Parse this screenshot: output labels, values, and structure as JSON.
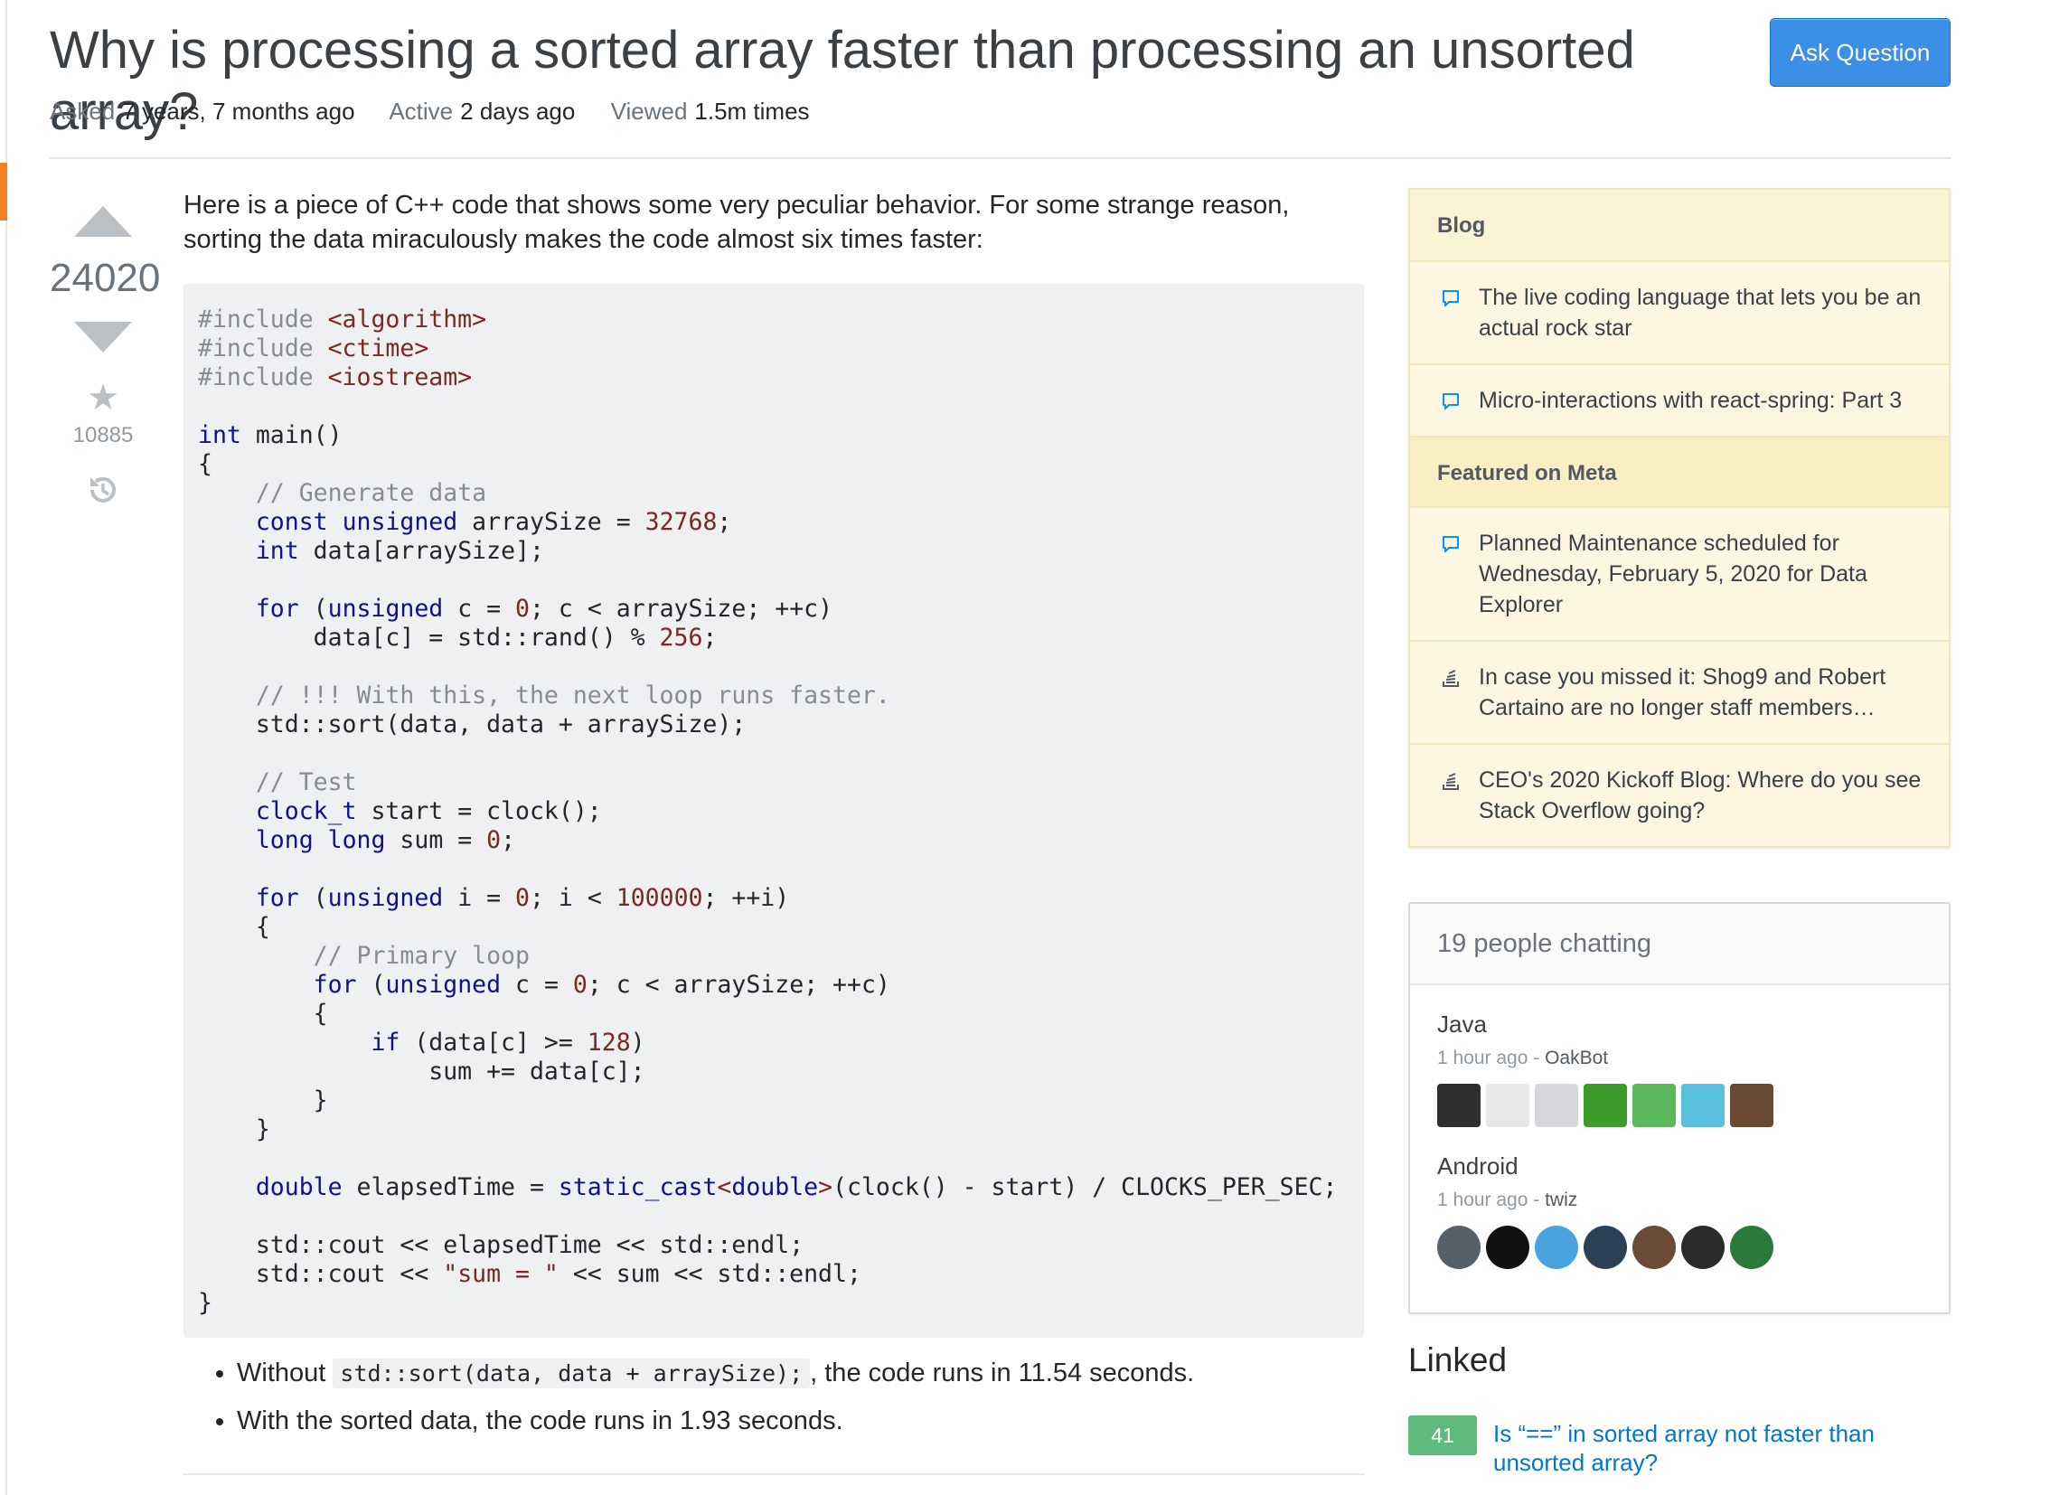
{
  "question": {
    "title": "Why is processing a sorted array faster than processing an unsorted array?",
    "meta": {
      "asked_label": "Asked",
      "asked_value": "7 years, 7 months ago",
      "active_label": "Active",
      "active_value": "2 days ago",
      "viewed_label": "Viewed",
      "viewed_value": "1.5m times"
    },
    "votes": "24020",
    "favorites": "10885",
    "body_intro": "Here is a piece of C++ code that shows some very peculiar behavior. For some strange reason, sorting the data miraculously makes the code almost six times faster:",
    "code_lines": [
      [
        [
          "c",
          "#include "
        ],
        [
          "s",
          "<algorithm>"
        ]
      ],
      [
        [
          "c",
          "#include "
        ],
        [
          "s",
          "<ctime>"
        ]
      ],
      [
        [
          "c",
          "#include "
        ],
        [
          "s",
          "<iostream>"
        ]
      ],
      [],
      [
        [
          "k",
          "int"
        ],
        [
          "p",
          " main()"
        ]
      ],
      [
        [
          "p",
          "{"
        ]
      ],
      [
        [
          "p",
          "    "
        ],
        [
          "c",
          "// Generate data"
        ]
      ],
      [
        [
          "p",
          "    "
        ],
        [
          "k",
          "const"
        ],
        [
          "p",
          " "
        ],
        [
          "k",
          "unsigned"
        ],
        [
          "p",
          " arraySize = "
        ],
        [
          "s",
          "32768"
        ],
        [
          "p",
          ";"
        ]
      ],
      [
        [
          "p",
          "    "
        ],
        [
          "k",
          "int"
        ],
        [
          "p",
          " data[arraySize];"
        ]
      ],
      [],
      [
        [
          "p",
          "    "
        ],
        [
          "k",
          "for"
        ],
        [
          "p",
          " ("
        ],
        [
          "k",
          "unsigned"
        ],
        [
          "p",
          " c = "
        ],
        [
          "s",
          "0"
        ],
        [
          "p",
          "; c < arraySize; ++c)"
        ]
      ],
      [
        [
          "p",
          "        data[c] = std::rand() % "
        ],
        [
          "s",
          "256"
        ],
        [
          "p",
          ";"
        ]
      ],
      [],
      [
        [
          "p",
          "    "
        ],
        [
          "c",
          "// !!! With this, the next loop runs faster."
        ]
      ],
      [
        [
          "p",
          "    std::sort(data, data + arraySize);"
        ]
      ],
      [],
      [
        [
          "p",
          "    "
        ],
        [
          "c",
          "// Test"
        ]
      ],
      [
        [
          "p",
          "    "
        ],
        [
          "k",
          "clock_t"
        ],
        [
          "p",
          " start = clock();"
        ]
      ],
      [
        [
          "p",
          "    "
        ],
        [
          "k",
          "long"
        ],
        [
          "p",
          " "
        ],
        [
          "k",
          "long"
        ],
        [
          "p",
          " sum = "
        ],
        [
          "s",
          "0"
        ],
        [
          "p",
          ";"
        ]
      ],
      [],
      [
        [
          "p",
          "    "
        ],
        [
          "k",
          "for"
        ],
        [
          "p",
          " ("
        ],
        [
          "k",
          "unsigned"
        ],
        [
          "p",
          " i = "
        ],
        [
          "s",
          "0"
        ],
        [
          "p",
          "; i < "
        ],
        [
          "s",
          "100000"
        ],
        [
          "p",
          "; ++i)"
        ]
      ],
      [
        [
          "p",
          "    {"
        ]
      ],
      [
        [
          "p",
          "        "
        ],
        [
          "c",
          "// Primary loop"
        ]
      ],
      [
        [
          "p",
          "        "
        ],
        [
          "k",
          "for"
        ],
        [
          "p",
          " ("
        ],
        [
          "k",
          "unsigned"
        ],
        [
          "p",
          " c = "
        ],
        [
          "s",
          "0"
        ],
        [
          "p",
          "; c < arraySize; ++c)"
        ]
      ],
      [
        [
          "p",
          "        {"
        ]
      ],
      [
        [
          "p",
          "            "
        ],
        [
          "k",
          "if"
        ],
        [
          "p",
          " (data[c] >= "
        ],
        [
          "s",
          "128"
        ],
        [
          "p",
          ")"
        ]
      ],
      [
        [
          "p",
          "                sum += data[c];"
        ]
      ],
      [
        [
          "p",
          "        }"
        ]
      ],
      [
        [
          "p",
          "    }"
        ]
      ],
      [],
      [
        [
          "p",
          "    "
        ],
        [
          "k",
          "double"
        ],
        [
          "p",
          " elapsedTime = "
        ],
        [
          "k",
          "static_cast"
        ],
        [
          "s",
          "<"
        ],
        [
          "k",
          "double"
        ],
        [
          "s",
          ">"
        ],
        [
          "p",
          "(clock() - start) / CLOCKS_PER_SEC;"
        ]
      ],
      [],
      [
        [
          "p",
          "    std::cout << elapsedTime << std::endl;"
        ]
      ],
      [
        [
          "p",
          "    std::cout << "
        ],
        [
          "s",
          "\"sum = \""
        ],
        [
          "p",
          " << sum << std::endl;"
        ]
      ],
      [
        [
          "p",
          "}"
        ]
      ]
    ],
    "bullet1_pre": "Without",
    "bullet1_code": "std::sort(data, data + arraySize);",
    "bullet1_post": ", the code runs in 11.54 seconds.",
    "bullet2": "With the sorted data, the code runs in 1.93 seconds."
  },
  "ask_button": "Ask Question",
  "sidebar": {
    "blog_header": "Blog",
    "blog_items": [
      {
        "icon": "speech-bubble-icon",
        "text": "The live coding language that lets you be an actual rock star"
      },
      {
        "icon": "speech-bubble-icon",
        "text": "Micro-interactions with react-spring: Part 3"
      }
    ],
    "meta_header": "Featured on Meta",
    "meta_items": [
      {
        "icon": "speech-bubble-icon",
        "text": "Planned Maintenance scheduled for Wednesday, February 5, 2020 for Data Explorer"
      },
      {
        "icon": "stack-exchange-icon",
        "text": "In case you missed it: Shog9 and Robert Cartaino are no longer staff members…"
      },
      {
        "icon": "stack-exchange-icon",
        "text": "CEO's 2020 Kickoff Blog: Where do you see Stack Overflow going?"
      }
    ]
  },
  "chat": {
    "header": "19 people chatting",
    "rooms": [
      {
        "name": "Java",
        "time": "1 hour ago",
        "sep": " - ",
        "user": "OakBot",
        "avatars": [
          "#2f2f2f",
          "#e8e8e8",
          "#d5d7da",
          "#3d9b2c",
          "#5cb85c",
          "#5bc0de",
          "#6b4a34"
        ]
      },
      {
        "name": "Android",
        "time": "1 hour ago",
        "sep": " - ",
        "user": "twiz",
        "avatars": [
          "#56606a",
          "#111111",
          "#4aa3df",
          "#2b3f55",
          "#6b4b35",
          "#2a2a2a",
          "#2c7a3a"
        ]
      }
    ]
  },
  "linked": {
    "title": "Linked",
    "items": [
      {
        "score": "41",
        "text": "Is “==” in sorted array not faster than unsorted array?"
      }
    ]
  },
  "colors": {
    "accent": "#3d8fe6",
    "link": "#0077cc",
    "linked_score": "#5eba7d",
    "sidebar_bg": "#fbf3d5",
    "orange": "#f48024"
  }
}
